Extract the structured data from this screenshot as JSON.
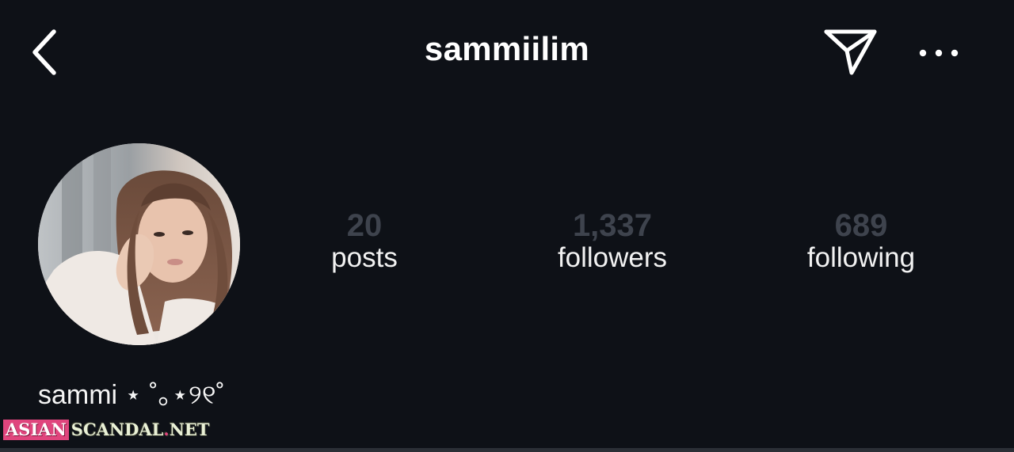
{
  "header": {
    "title": "sammiilim",
    "back_icon": "chevron-left-icon",
    "share_icon": "paper-plane-icon",
    "more_icon": "more-horizontal-icon"
  },
  "profile": {
    "display_name": "sammi ⋆ ˚｡⋆୨୧˚",
    "stats": {
      "posts": {
        "value": "20",
        "label": "posts"
      },
      "followers": {
        "value": "1,337",
        "label": "followers"
      },
      "following": {
        "value": "689",
        "label": "following"
      }
    }
  },
  "watermark": {
    "part1": "ASIAN",
    "part2a": "SCANDAL",
    "dot": ".",
    "part2b": "NET"
  },
  "colors": {
    "background": "#0e1117",
    "stat_value": "#3e434d",
    "watermark_accent": "#e0457d"
  }
}
